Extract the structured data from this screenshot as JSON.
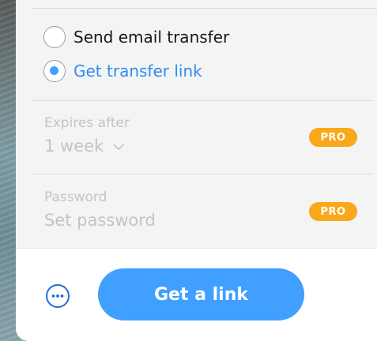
{
  "transfer_options": [
    {
      "label": "Send email transfer",
      "selected": false
    },
    {
      "label": "Get transfer link",
      "selected": true
    }
  ],
  "expires": {
    "label": "Expires after",
    "value": "1 week",
    "badge": "PRO"
  },
  "password": {
    "label": "Password",
    "placeholder": "Set password",
    "badge": "PRO"
  },
  "footer": {
    "more_icon": "more-options-icon",
    "cta_label": "Get a link"
  },
  "colors": {
    "accent": "#409fff",
    "pro_badge": "#f8a819",
    "disabled_text": "#c4c4c8"
  }
}
